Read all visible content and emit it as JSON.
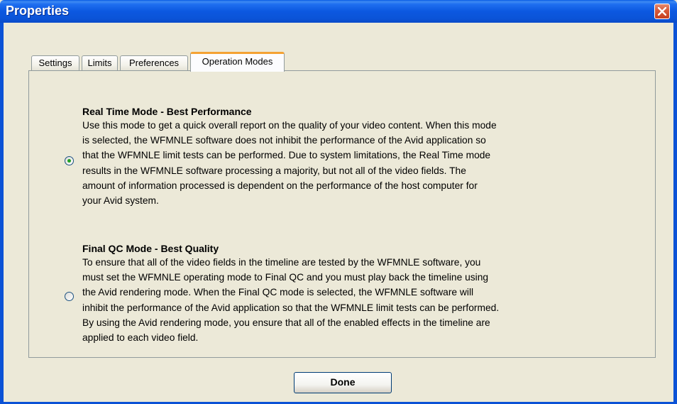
{
  "window": {
    "title": "Properties"
  },
  "tabs": [
    {
      "label": "Settings",
      "active": false
    },
    {
      "label": "Limits",
      "active": false
    },
    {
      "label": "Preferences",
      "active": false
    },
    {
      "label": "Operation Modes",
      "active": true
    }
  ],
  "modes": [
    {
      "title": "Real Time Mode - Best Performance",
      "selected": true,
      "lines": [
        "Use this mode to get a quick overall report on the quality of your video content. When this mode",
        "is selected, the WFMNLE software does not inhibit the performance of the Avid application so",
        "that the WFMNLE limit tests can be performed. Due to system limitations, the Real Time mode",
        "results in the WFMNLE software processing a majority, but not all of the video fields. The",
        "amount of information processed is dependent on the performance of the host computer for",
        "your Avid system."
      ]
    },
    {
      "title": "Final QC Mode - Best Quality",
      "selected": false,
      "lines": [
        "To ensure that all of the video fields in the timeline are tested by the WFMNLE software, you",
        "must set the WFMNLE operating mode to Final QC and you must play back the timeline using",
        "the Avid rendering mode. When the Final QC mode is selected, the WFMNLE software will",
        "inhibit the performance of the Avid application so that the WFMNLE limit tests can be performed.",
        "By using the Avid rendering mode, you ensure that all of the enabled effects in the timeline are",
        "applied to each video field."
      ]
    }
  ],
  "buttons": {
    "done": "Done"
  },
  "icons": {
    "close": "close-icon"
  },
  "colors": {
    "titlebar": "#0b54d8",
    "active_tab_accent": "#f4a233",
    "close_button": "#d85c3c",
    "radio_dot": "#21a121"
  }
}
